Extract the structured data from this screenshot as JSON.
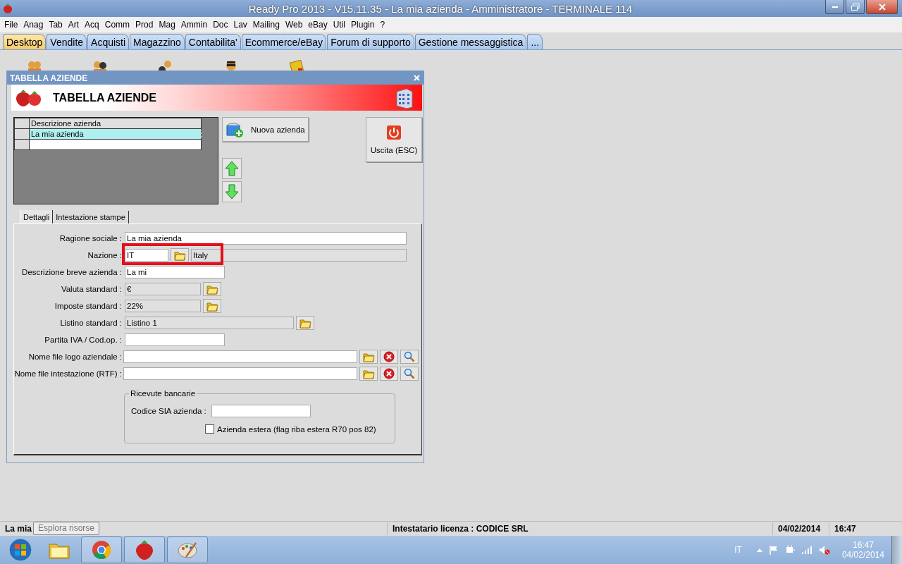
{
  "window": {
    "title": "Ready Pro 2013 - V15.11.35 - La mia azienda - Amministratore - TERMINALE 114"
  },
  "menu": [
    "File",
    "Anag",
    "Tab",
    "Art",
    "Acq",
    "Comm",
    "Prod",
    "Mag",
    "Ammin",
    "Doc",
    "Lav",
    "Mailing",
    "Web",
    "eBay",
    "Util",
    "Plugin",
    "?"
  ],
  "tabs": [
    {
      "label": "Desktop",
      "selected": true
    },
    {
      "label": "Vendite",
      "selected": false
    },
    {
      "label": "Acquisti",
      "selected": false
    },
    {
      "label": "Magazzino",
      "selected": false
    },
    {
      "label": "Contabilita'",
      "selected": false
    },
    {
      "label": "Ecommerce/eBay",
      "selected": false
    },
    {
      "label": "Forum di supporto",
      "selected": false
    },
    {
      "label": "Gestione messaggistica",
      "selected": false
    },
    {
      "label": "...",
      "selected": false
    }
  ],
  "dialog": {
    "title": "TABELLA AZIENDE",
    "header": "TABELLA AZIENDE",
    "grid": {
      "columns": [
        "Descrizione azienda"
      ],
      "rows": [
        {
          "cells": [
            "La mia azienda"
          ],
          "selected": true
        }
      ]
    },
    "new_button": "Nuova azienda",
    "exit_button": "Uscita (ESC)",
    "tabs": [
      {
        "label": "Dettagli",
        "selected": true
      },
      {
        "label": "Intestazione stampe",
        "selected": false
      }
    ],
    "fields": [
      {
        "kind": "wide",
        "label": "Ragione sociale :",
        "value": "La mia azienda"
      },
      {
        "kind": "country",
        "label": "Nazione :",
        "value": "IT",
        "description": "Italy",
        "highlighted": true
      },
      {
        "kind": "short",
        "label": "Descrizione breve azienda :",
        "value": "La mi"
      },
      {
        "kind": "lookup",
        "label": "Valuta standard :",
        "value": "€"
      },
      {
        "kind": "lookup",
        "label": "Imposte standard :",
        "value": "22%"
      },
      {
        "kind": "lookup-long",
        "label": "Listino standard :",
        "value": "Listino 1"
      },
      {
        "kind": "short",
        "label": "Partita IVA / Cod.op. :"
      },
      {
        "kind": "file",
        "label": "Nome file logo aziendale :"
      },
      {
        "kind": "file",
        "label": "Nome file intestazione (RTF) :"
      }
    ],
    "bank": {
      "title": "Ricevute bancarie",
      "field_label": "Codice SIA azienda :",
      "checkbox": {
        "label": "Azienda estera (flag riba estera R70 pos 82)",
        "checked": false
      }
    }
  },
  "status_bar": [
    "La mia",
    "Intestatario licenza : CODICE SRL",
    "04/02/2014",
    "16:47"
  ],
  "tooltip": "Esplora risorse",
  "taskbar": {
    "language": "IT",
    "time": "16:47",
    "date": "04/02/2014"
  }
}
